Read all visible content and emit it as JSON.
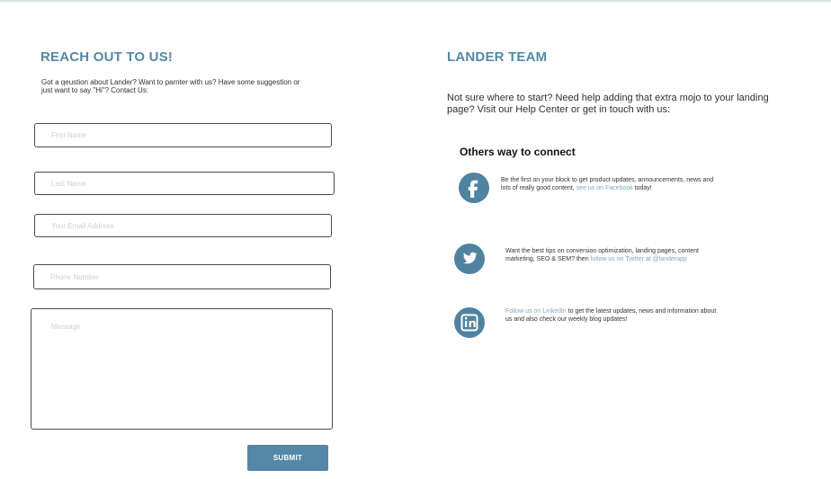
{
  "theme": {
    "accent": "#5488a6",
    "icon_color": "#4f83a0",
    "link_color": "#7fa8c0"
  },
  "contact": {
    "title": "REACH OUT TO US!",
    "intro": "Got a qeustion about Lander? Want to parnter with us? Have some suggestion or just want to say \"Hi\"? Contact Us:",
    "first_name_placeholder": "First Name",
    "last_name_placeholder": "Last Name",
    "email_placeholder": "Your Email Address",
    "phone_placeholder": "Phone Number",
    "message_placeholder": "Message",
    "submit_label": "SUBMIT"
  },
  "team": {
    "title": "LANDER TEAM",
    "intro": "Not sure where to start? Need help adding that extra mojo to your landing page? Visit our Help Center or get in touch with us:",
    "connect_title": "Others way to connect"
  },
  "social": {
    "facebook": {
      "icon": "facebook-icon",
      "text_before": "Be the first on your block to get product updates, announcements, news and lots of really good content, ",
      "link": "see us on Facebook",
      "text_after": " today!"
    },
    "twitter": {
      "icon": "twitter-icon",
      "text_before": "Want the best tips on conversion optimization, landing pages,  content marketing, SEO & SEM? then ",
      "link": "follow us on Twitter at @landerapp",
      "text_after": ""
    },
    "linkedin": {
      "icon": "linkedin-icon",
      "link": "Follow us on LinkedIn",
      "text_after": " to get the latest updates, news and information about us and also check our weekly blog updates!"
    }
  }
}
